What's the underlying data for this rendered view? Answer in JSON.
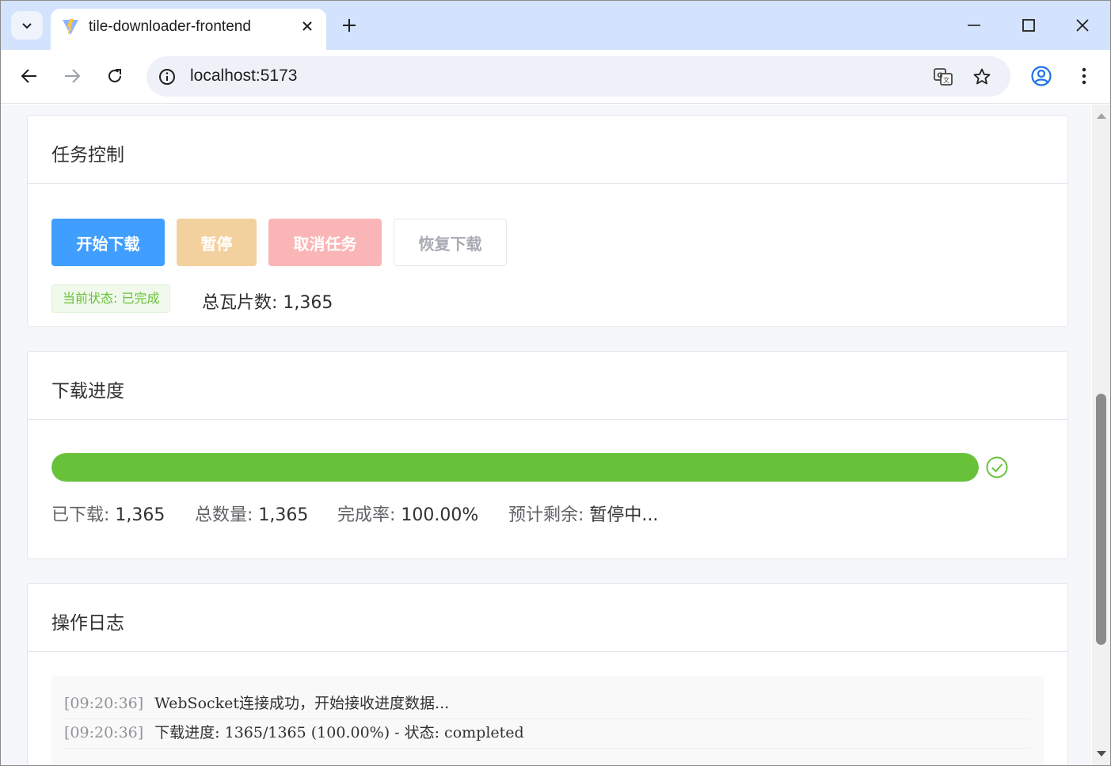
{
  "browser": {
    "tab_title": "tile-downloader-frontend",
    "url": "localhost:5173"
  },
  "icons": {
    "tab_search": "chevron-down-icon",
    "favicon": "vite-logo-icon",
    "tab_close": "close-icon",
    "new_tab": "plus-icon",
    "minimize": "minimize-icon",
    "maximize": "maximize-icon",
    "close_window": "close-icon",
    "back": "arrow-left-icon",
    "forward": "arrow-right-icon",
    "reload": "reload-icon",
    "site_info": "info-icon",
    "translate": "translate-icon",
    "bookmark": "star-icon",
    "profile": "account-circle-icon",
    "menu": "more-vertical-icon",
    "progress_done": "check-circle-icon"
  },
  "task_control": {
    "title": "任务控制",
    "buttons": {
      "start": "开始下载",
      "pause": "暂停",
      "cancel": "取消任务",
      "resume": "恢复下载"
    },
    "status_tag": "当前状态: 已完成",
    "total_tiles": "总瓦片数: 1,365"
  },
  "progress": {
    "title": "下载进度",
    "percent": 100,
    "downloaded_label": "已下载:",
    "downloaded_value": "1,365",
    "total_label": "总数量:",
    "total_value": "1,365",
    "rate_label": "完成率:",
    "rate_value": "100.00%",
    "eta_label": "预计剩余:",
    "eta_value": "暂停中..."
  },
  "log": {
    "title": "操作日志",
    "entries": [
      {
        "time": "[09:20:36]",
        "message": "WebSocket连接成功，开始接收进度数据..."
      },
      {
        "time": "[09:20:36]",
        "message": "下载进度: 1365/1365 (100.00%) - 状态: completed"
      }
    ]
  },
  "colors": {
    "primary": "#409eff",
    "warning_disabled": "#f3d19e",
    "danger_disabled": "#fab6b6",
    "success": "#67c23a",
    "tab_strip": "#d3e3fd"
  }
}
